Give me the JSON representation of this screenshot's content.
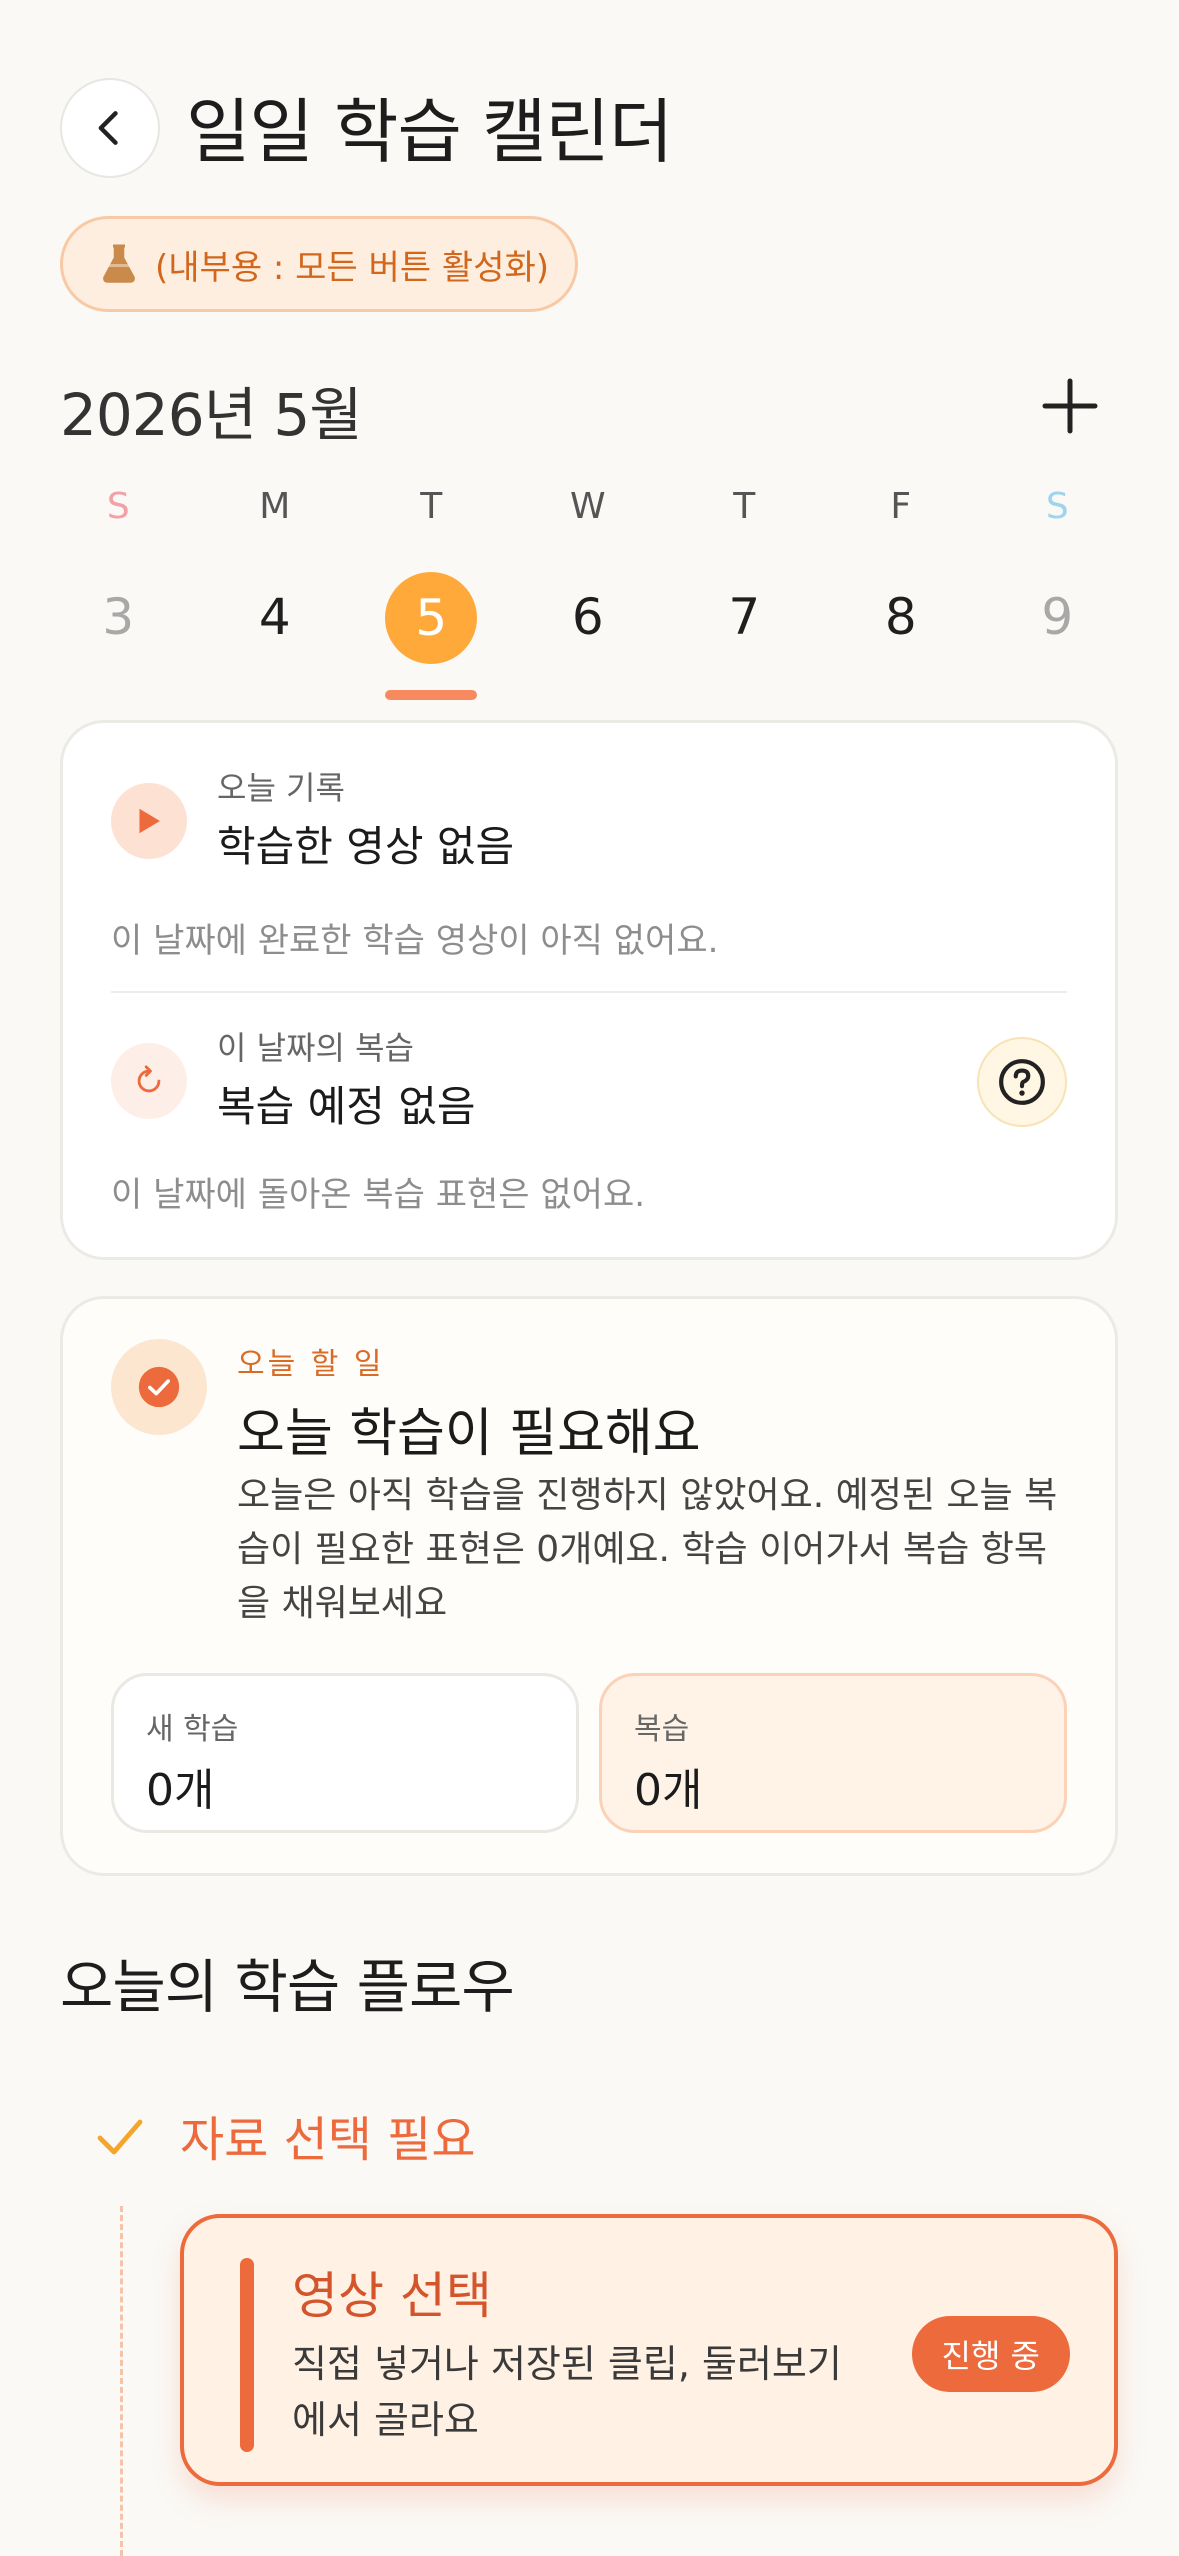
{
  "header": {
    "title": "일일 학습 캘린더",
    "back_icon": "chevron-left-icon",
    "badge_text": "(내부용 : 모든 버튼 활성화)",
    "badge_icon": "flask-icon"
  },
  "calendar": {
    "month_label": "2026년 5월",
    "add_icon": "plus-icon",
    "weekdays": [
      "S",
      "M",
      "T",
      "W",
      "T",
      "F",
      "S"
    ],
    "days": [
      "3",
      "4",
      "5",
      "6",
      "7",
      "8",
      "9"
    ],
    "selected_index": 2
  },
  "today_record": {
    "record_label": "오늘 기록",
    "record_title": "학습한 영상 없음",
    "record_desc": "이 날짜에 완료한 학습 영상이 아직 없어요.",
    "review_label": "이 날짜의 복습",
    "review_title": "복습 예정 없음",
    "review_desc": "이 날짜에 돌아온 복습 표현은 없어요."
  },
  "todo": {
    "label": "오늘 할 일",
    "title": "오늘 학습이 필요해요",
    "desc": "오늘은 아직 학습을 진행하지 않았어요. 예정된 오늘 복습이 필요한 표현은 0개예요. 학습 이어가서 복습 항목을 채워보세요",
    "new_label": "새 학습",
    "new_value": "0개",
    "review_label": "복습",
    "review_value": "0개"
  },
  "flow": {
    "title": "오늘의 학습 플로우",
    "step_title": "자료 선택 필요",
    "card_title": "영상 선택",
    "card_desc": "직접 넣거나 저장된 클립, 둘러보기에서 골라요",
    "status": "진행 중"
  },
  "colors": {
    "accent": "#ec6a3c",
    "selected_day": "#ffa93b",
    "badge_text": "#d2671c"
  }
}
